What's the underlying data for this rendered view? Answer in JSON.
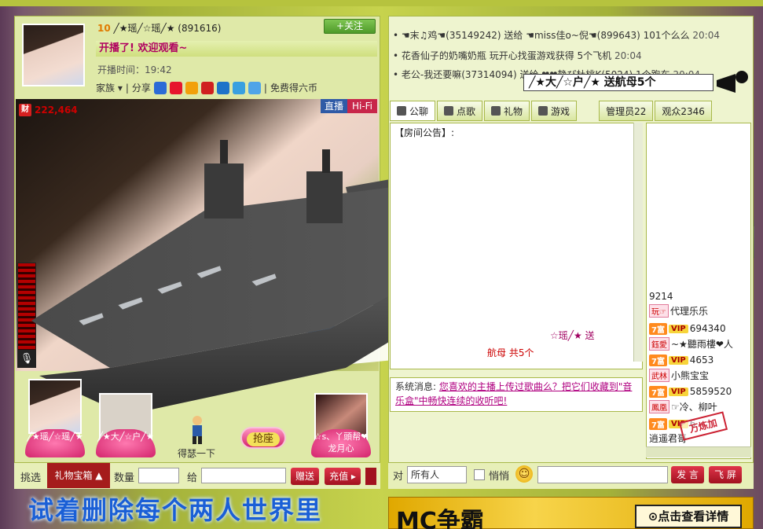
{
  "host": {
    "level": "10",
    "name": "╱★瑶╱☆瑶╱★",
    "id": "891616",
    "follow_label": "+关注",
    "welcome": "开播了! 欢迎观看~",
    "start_time": "开播时间：19:42",
    "family_label": "家族",
    "share_label": "分享",
    "free_coins": "免费得六币"
  },
  "video": {
    "fortune_value": "222,464",
    "fortune_icon_label": "财",
    "live_badge": "直播",
    "hifi_badge": "Hi-Fi"
  },
  "seats": [
    {
      "label": "╱★瑶╱☆瑶╱★"
    },
    {
      "label": "╱★大╱☆户╱★"
    },
    {
      "label": "☆s、丫頭帮❤龙月心"
    }
  ],
  "grab_seat": "抢座",
  "seat_caption": "得瑟一下",
  "gift_bar": {
    "pick_label": "挑选",
    "gift_box_label": "礼物宝箱",
    "qty_label": "数量",
    "give_label": "给",
    "send_label": "赠送",
    "recharge_label": "充值"
  },
  "bottom_text": "试着删除每个两人世界里",
  "announcements": [
    {
      "text": "• ☚末♫鸡☚(35149242) 送给 ☚miss佳o~倪☚(899643) 101个么么",
      "time": "20:04"
    },
    {
      "text": "• 花香仙子的奶嘴奶瓶 玩开心找蛋游戏获得 5个飞机",
      "time": "20:04"
    },
    {
      "text": "• 老公-我还要嘛(37314094) 送给 ❤❤静ぴ杜桃K(5024) 1个跑车",
      "time": "20:04"
    }
  ],
  "gift_shout": "╱★大╱☆户╱★ 送航母5个",
  "tabs": [
    {
      "label": "公聊",
      "icon": "chat-icon"
    },
    {
      "label": "点歌",
      "icon": "mic-icon"
    },
    {
      "label": "礼物",
      "icon": "gift-icon"
    },
    {
      "label": "游戏",
      "icon": "game-icon"
    },
    {
      "label": "管理员22",
      "icon": ""
    },
    {
      "label": "观众2346",
      "icon": ""
    }
  ],
  "room_announce": "【房间公告】:",
  "chat_lines": [
    "☆瑶╱★ 送",
    "航母 共5个"
  ],
  "system_msg": {
    "prefix": "系统消息:",
    "link": "您喜欢的主播上传过歌曲么？把它们收藏到\"音乐盒\"中畅快连续的收听吧!"
  },
  "users": [
    {
      "badges": [
        "",
        "玩☞"
      ],
      "name": "代理乐乐"
    },
    {
      "badges": [
        "7富",
        "VIP"
      ],
      "name": "694340"
    },
    {
      "badges": [
        "鈺愛"
      ],
      "name": "~★聽雨樓❤人"
    },
    {
      "badges": [
        "7富",
        "VIP"
      ],
      "name": "4653"
    },
    {
      "badges": [
        "武林"
      ],
      "name": "小熊宝宝"
    },
    {
      "badges": [
        "7富",
        "VIP"
      ],
      "name": "5859520"
    },
    {
      "badges": [
        "鳳凰"
      ],
      "name": "☞冷、柳叶"
    },
    {
      "badges": [
        "7富",
        "VIP"
      ],
      "name": "6"
    },
    {
      "badges": [],
      "name": "逍遥君哥"
    }
  ],
  "user_count_partial": "9214",
  "stamp_text": "万炼加",
  "chat_input": {
    "to_label": "对",
    "to_value": "所有人",
    "whisper_label": "悄悄",
    "speak_label": "发 言",
    "fly_label": "飞 屏"
  },
  "banner_right": {
    "title": "MC争霸",
    "cta": "⊙点击查看详情"
  },
  "colors": {
    "brand_green": "#a3b13a",
    "accent_red": "#a1121f",
    "accent_pink": "#d3246c",
    "link_purple": "#b00080"
  }
}
